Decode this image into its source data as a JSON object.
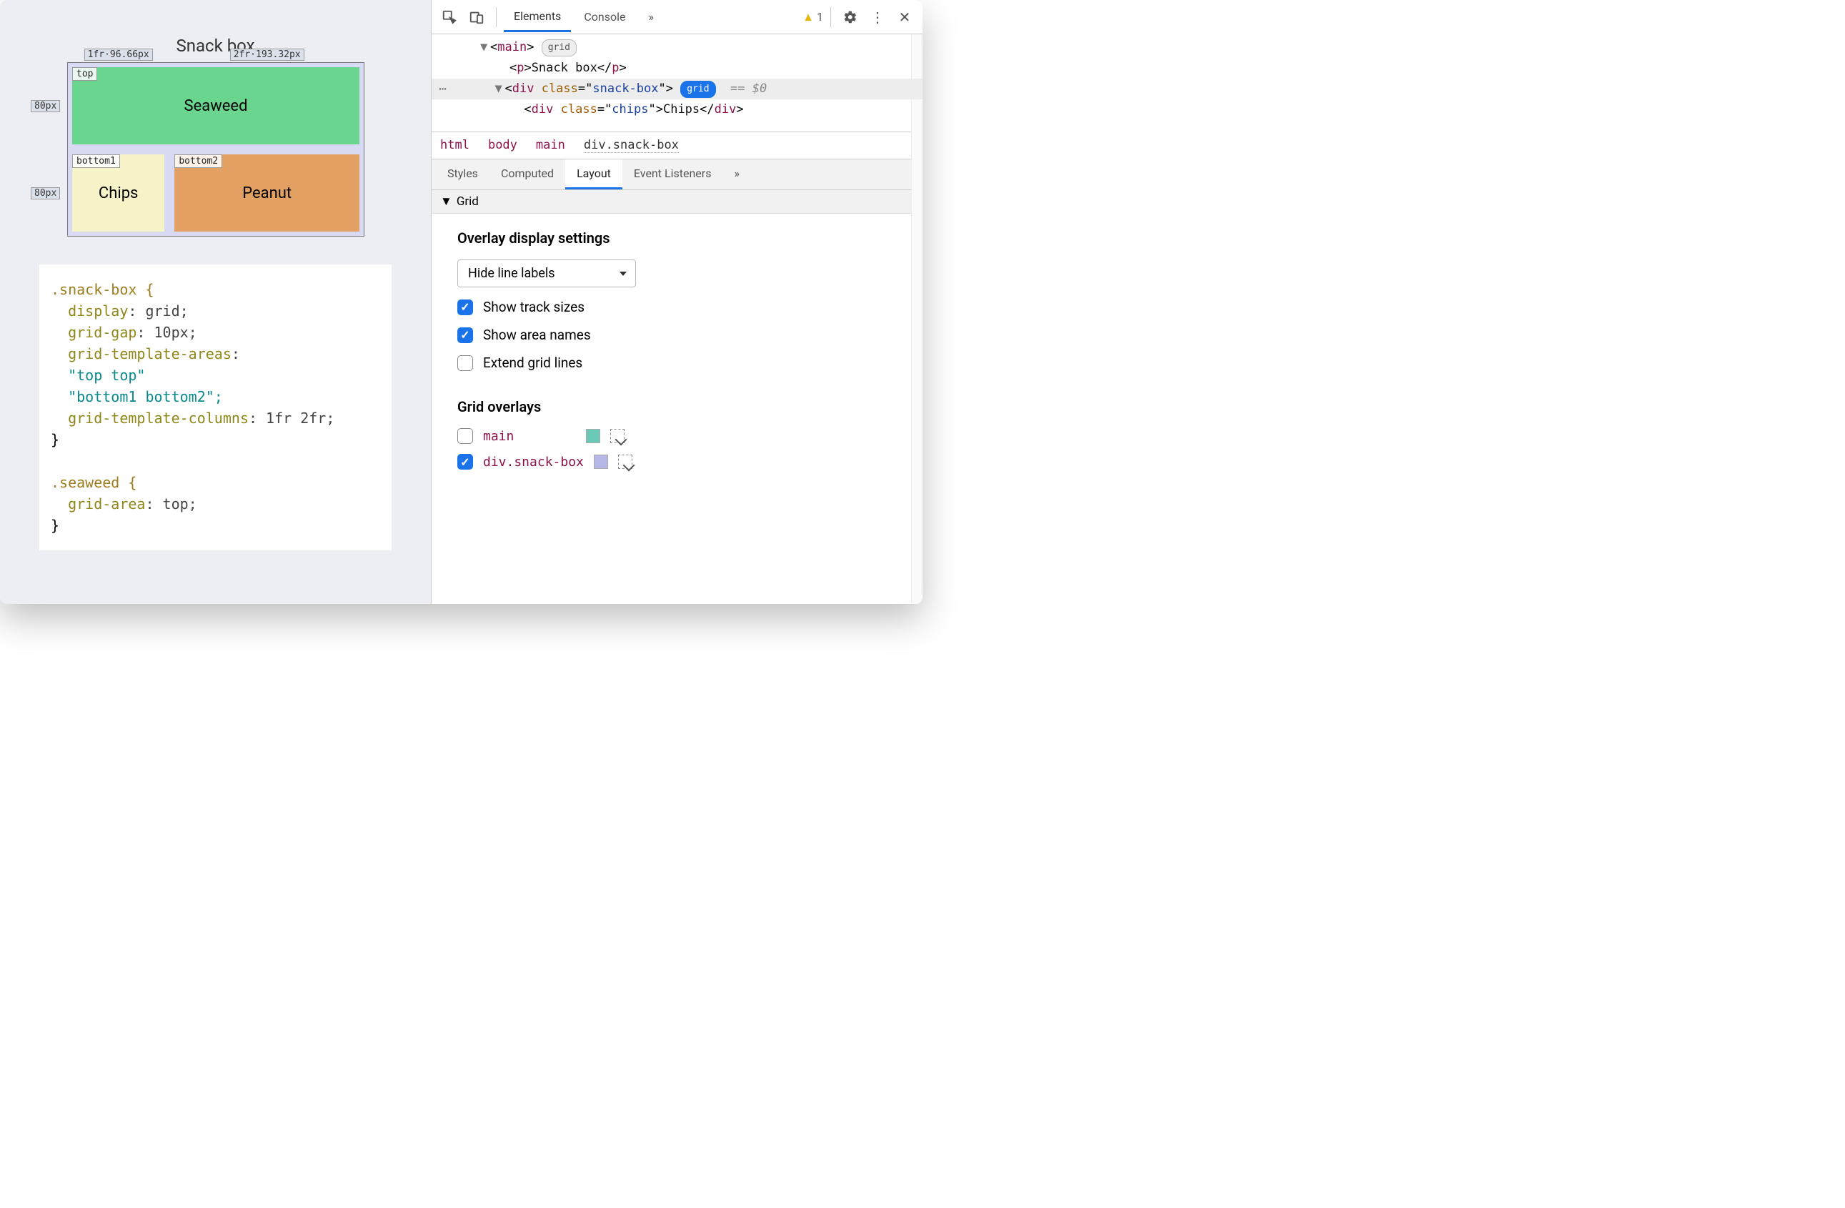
{
  "preview": {
    "title": "Snack box",
    "col_tracks": [
      "1fr·96.66px",
      "2fr·193.32px"
    ],
    "row_tracks": [
      "80px",
      "80px"
    ],
    "areas": {
      "top": "top",
      "bottom1": "bottom1",
      "bottom2": "bottom2"
    },
    "cells": {
      "seaweed": "Seaweed",
      "chips": "Chips",
      "peanut": "Peanut"
    }
  },
  "code": {
    "l1": ".snack-box {",
    "l2a": "  display",
    "l2b": ": grid;",
    "l3a": "  grid-gap",
    "l3b": ": 10px;",
    "l4a": "  grid-template-areas",
    "l4b": ":",
    "l5": "  \"top top\"",
    "l6": "  \"bottom1 bottom2\";",
    "l7a": "  grid-template-columns",
    "l7b": ": 1fr 2fr;",
    "l8": "}",
    "l9": "",
    "l10": ".seaweed {",
    "l11a": "  grid-area",
    "l11b": ": top;",
    "l12": "}"
  },
  "toolbar": {
    "tabs": {
      "elements": "Elements",
      "console": "Console"
    },
    "overflow": "»",
    "warning_count": "1"
  },
  "dom": {
    "main_open": "main",
    "grid_badge": "grid",
    "p_text": "Snack box",
    "div_class": "snack-box",
    "eq": "== $0",
    "chips_class": "chips",
    "chips_text": "Chips"
  },
  "crumbs": [
    "html",
    "body",
    "main",
    "div.snack-box"
  ],
  "subtabs": {
    "styles": "Styles",
    "computed": "Computed",
    "layout": "Layout",
    "eventlisteners": "Event Listeners",
    "overflow": "»"
  },
  "layout": {
    "section": "Grid",
    "overlay_settings_title": "Overlay display settings",
    "line_labels_select": "Hide line labels",
    "show_track_sizes": "Show track sizes",
    "show_area_names": "Show area names",
    "extend_grid_lines": "Extend grid lines",
    "grid_overlays_title": "Grid overlays",
    "overlays": {
      "main": {
        "label": "main",
        "color": "#6bc9b8"
      },
      "snackbox": {
        "label": "div.snack-box",
        "color": "#b6b7e6"
      }
    }
  }
}
